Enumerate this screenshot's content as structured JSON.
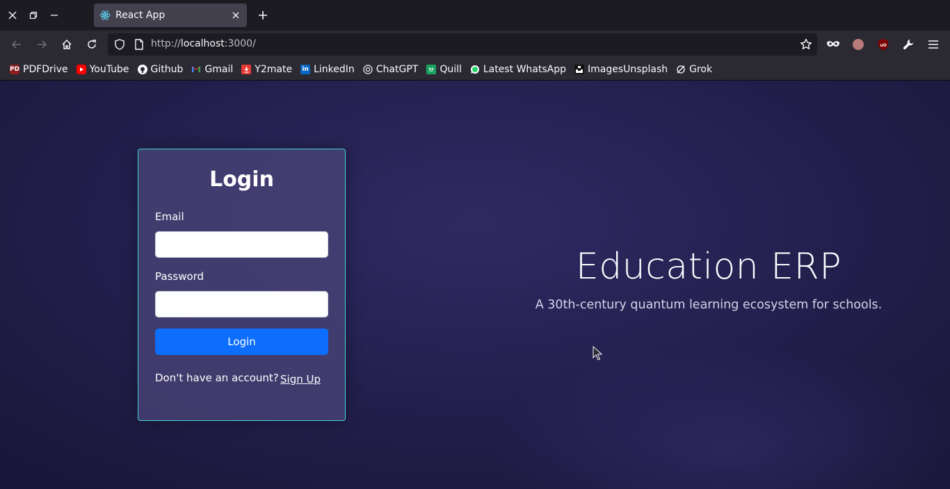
{
  "window": {
    "controls": [
      "close-icon",
      "restore-icon",
      "minimize-icon"
    ]
  },
  "tab": {
    "title": "React App",
    "icon": "react-icon",
    "close_icon": "close-icon"
  },
  "nav": {
    "url_scheme": "http://",
    "url_host": "localhost",
    "url_rest": ":3000/"
  },
  "bookmarks": [
    {
      "label": "PDFDrive",
      "icon": "pdfdrive-icon",
      "color": "#c0392b"
    },
    {
      "label": "YouTube",
      "icon": "youtube-icon",
      "color": "#ff0000"
    },
    {
      "label": "Github",
      "icon": "github-icon",
      "color": "#ffffff"
    },
    {
      "label": "Gmail",
      "icon": "gmail-icon",
      "color": "#ea4335"
    },
    {
      "label": "Y2mate",
      "icon": "y2mate-icon",
      "color": "#e53935"
    },
    {
      "label": "LinkedIn",
      "icon": "linkedin-icon",
      "color": "#0a66c2"
    },
    {
      "label": "ChatGPT",
      "icon": "chatgpt-icon",
      "color": "#ffffff"
    },
    {
      "label": "Quill",
      "icon": "quill-icon",
      "color": "#1aa260"
    },
    {
      "label": "Latest WhatsApp",
      "icon": "whatsapp-icon",
      "color": "#25d366"
    },
    {
      "label": "ImagesUnsplash",
      "icon": "unsplash-icon",
      "color": "#111111"
    },
    {
      "label": "Grok",
      "icon": "grok-icon",
      "color": "#ffffff"
    }
  ],
  "login": {
    "title": "Login",
    "email_label": "Email",
    "email_value": "",
    "password_label": "Password",
    "password_value": "",
    "submit_label": "Login",
    "no_account_text": "Don't have an account?",
    "signup_link": "Sign Up"
  },
  "hero": {
    "title": "Education ERP",
    "subtitle": "A 30th-century quantum learning ecosystem for schools."
  },
  "colors": {
    "accent_border": "#3fd6d8",
    "primary_button": "#0d6efd",
    "background": "#24204f"
  }
}
